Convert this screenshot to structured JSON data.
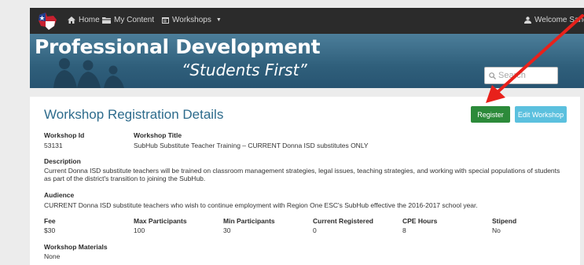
{
  "nav": {
    "home": "Home",
    "my_content": "My Content",
    "workshops": "Workshops",
    "welcome": "Welcome Sandy"
  },
  "banner": {
    "title": "Professional Development",
    "subtitle": "“Students First”"
  },
  "search": {
    "placeholder": "Search"
  },
  "page": {
    "title": "Workshop Registration Details",
    "register_label": "Register",
    "edit_label": "Edit Workshop"
  },
  "workshop": {
    "id_label": "Workshop Id",
    "id_value": "53131",
    "title_label": "Workshop Title",
    "title_value": "SubHub Substitute Teacher Training – CURRENT Donna ISD substitutes ONLY",
    "description_label": "Description",
    "description_value": "Current Donna ISD substitute teachers will be trained on classroom management strategies, legal issues, teaching strategies, and working with special populations of students as part of the district's transition to joining the SubHub.",
    "audience_label": "Audience",
    "audience_value": "CURRENT Donna ISD substitute teachers who wish to continue employment with Region One ESC's SubHub effective the 2016-2017 school year.",
    "fee_label": "Fee",
    "fee_value": "$30",
    "max_label": "Max Participants",
    "max_value": "100",
    "min_label": "Min Participants",
    "min_value": "30",
    "registered_label": "Current Registered",
    "registered_value": "0",
    "cpe_label": "CPE Hours",
    "cpe_value": "8",
    "stipend_label": "Stipend",
    "stipend_value": "No",
    "materials_label": "Workshop Materials",
    "materials_value": "None"
  },
  "colors": {
    "accent_title": "#2d6b8c",
    "register_button": "#2c8a3a",
    "edit_button": "#5bc0de",
    "annotation_arrow": "#e8211b"
  },
  "icons": [
    "texas-flag-logo",
    "home-icon",
    "folder-icon",
    "calendar-icon",
    "user-icon",
    "search-icon"
  ]
}
